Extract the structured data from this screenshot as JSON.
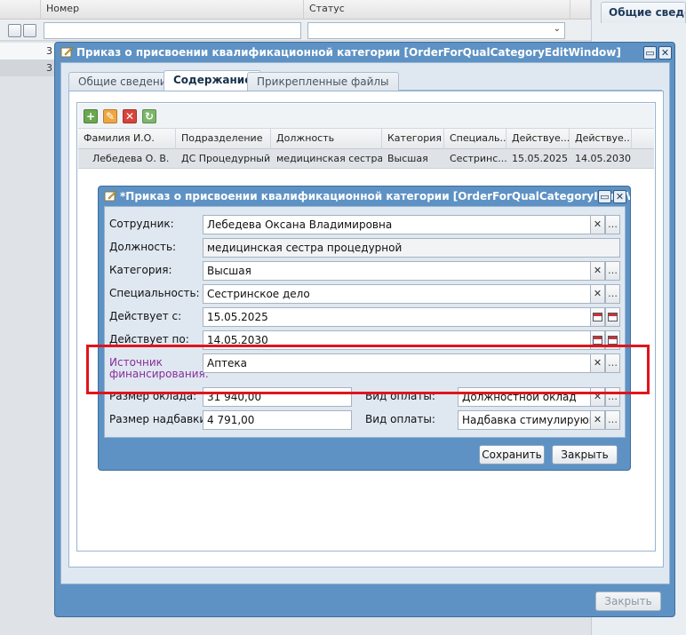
{
  "background": {
    "columns": [
      "Номер",
      "Статус"
    ],
    "rows": [
      "3",
      "3"
    ],
    "right_tab": "Общие сведения"
  },
  "outer_window": {
    "title": "Приказ о присвоении квалификационной категории [OrderForQualCategoryEditWindow]",
    "tabs": [
      "Общие сведения",
      "Содержание",
      "Прикрепленные файлы"
    ],
    "active_tab": 1,
    "toolbar": {
      "add_icon": "add-icon",
      "edit_icon": "pencil-icon",
      "delete_icon": "delete-icon",
      "refresh_icon": "refresh-icon"
    },
    "grid": {
      "headers": [
        "Фамилия И.О.",
        "Подразделение",
        "Должность",
        "Категория",
        "Специаль...",
        "Действуе...",
        "Действуе..."
      ],
      "rows": [
        [
          "Лебедева О. В.",
          "ДС Процедурный...",
          "медицинская сестра ...",
          "Высшая",
          "Сестринс...",
          "15.05.2025",
          "14.05.2030"
        ]
      ]
    },
    "close_button": "Закрыть"
  },
  "inner_window": {
    "title": "*Приказ о присвоении квалификационной категории [OrderForQualCategoryItemWindow]",
    "fields": {
      "employee": {
        "label": "Сотрудник:",
        "value": "Лебедева Оксана Владимировна"
      },
      "position": {
        "label": "Должность:",
        "value": "медицинская сестра процедурной"
      },
      "category": {
        "label": "Категория:",
        "value": "Высшая"
      },
      "specialty": {
        "label": "Специальность:",
        "value": "Сестринское дело"
      },
      "valid_from": {
        "label": "Действует с:",
        "value": "15.05.2025"
      },
      "valid_to": {
        "label": "Действует по:",
        "value": "14.05.2030"
      },
      "funding": {
        "label_line1": "Источник",
        "label_line2": "финансирования:",
        "value": "Аптека"
      },
      "salary": {
        "label": "Размер оклада:",
        "value": "31 940,00"
      },
      "payment_type_1": {
        "label": "Вид оплаты:",
        "value": "Должностной оклад"
      },
      "bonus": {
        "label": "Размер надбавки:",
        "value": "4 791,00"
      },
      "payment_type_2": {
        "label": "Вид оплаты:",
        "value": "Надбавка стимулирующего характера"
      }
    },
    "save_button": "Сохранить",
    "close_button": "Закрыть"
  },
  "colors": {
    "window_frame": "#5e92c4",
    "highlight_box": "#e0141c",
    "funding_label": "#8a2c99"
  }
}
